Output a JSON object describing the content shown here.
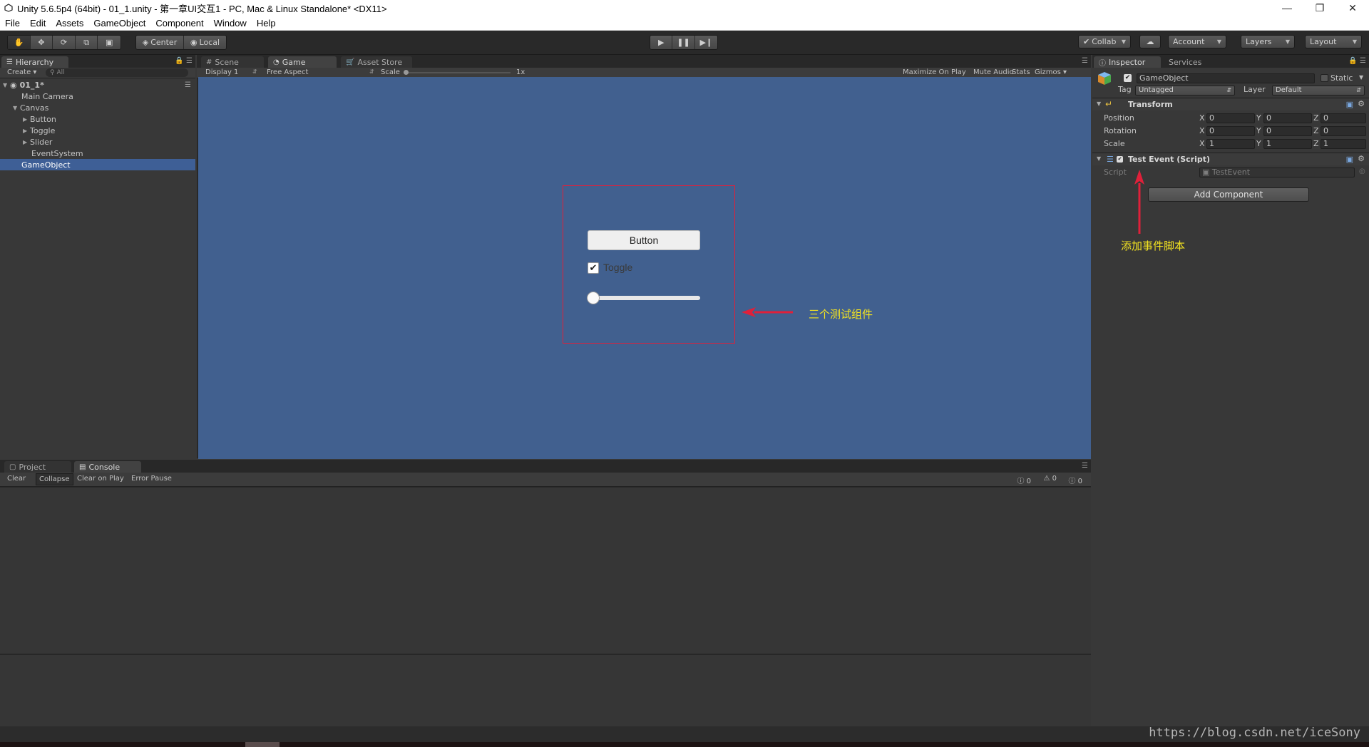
{
  "window": {
    "title": "Unity 5.6.5p4 (64bit) - 01_1.unity - 第一章UI交互1 - PC, Mac & Linux Standalone* <DX11>"
  },
  "menu": [
    "File",
    "Edit",
    "Assets",
    "GameObject",
    "Component",
    "Window",
    "Help"
  ],
  "toolbar": {
    "pivot": "Center",
    "space": "Local",
    "collab": "Collab",
    "account": "Account",
    "layers": "Layers",
    "layout": "Layout"
  },
  "hierarchy": {
    "tab": "Hierarchy",
    "create": "Create",
    "search_placeholder": "All",
    "scene": "01_1*",
    "items": [
      {
        "label": "Main Camera"
      },
      {
        "label": "Canvas"
      },
      {
        "label": "Button"
      },
      {
        "label": "Toggle"
      },
      {
        "label": "Slider"
      },
      {
        "label": "EventSystem"
      },
      {
        "label": "GameObject"
      }
    ]
  },
  "center": {
    "tabs": [
      "Scene",
      "Game",
      "Asset Store"
    ],
    "display": "Display 1",
    "aspect": "Free Aspect",
    "scale_label": "Scale",
    "scale_value": "1x",
    "opts": [
      "Maximize On Play",
      "Mute Audio",
      "Stats",
      "Gizmos"
    ]
  },
  "game": {
    "button_label": "Button",
    "toggle_label": "Toggle",
    "toggle_checked": true,
    "slider_value": 0,
    "annotation": "三个测试组件"
  },
  "inspector": {
    "tabs": [
      "Inspector",
      "Services"
    ],
    "object_name": "GameObject",
    "static_label": "Static",
    "tag_label": "Tag",
    "tag_value": "Untagged",
    "layer_label": "Layer",
    "layer_value": "Default",
    "transform": {
      "title": "Transform",
      "rows": [
        {
          "label": "Position",
          "x": "0",
          "y": "0",
          "z": "0"
        },
        {
          "label": "Rotation",
          "x": "0",
          "y": "0",
          "z": "0"
        },
        {
          "label": "Scale",
          "x": "1",
          "y": "1",
          "z": "1"
        }
      ]
    },
    "script_comp": {
      "title": "Test Event (Script)",
      "script_label": "Script",
      "script_value": "TestEvent"
    },
    "add_component": "Add Component",
    "annotation": "添加事件脚本"
  },
  "bottom": {
    "tabs": [
      "Project",
      "Console"
    ],
    "buttons": [
      "Clear",
      "Collapse",
      "Clear on Play",
      "Error Pause"
    ],
    "counts": {
      "info": "0",
      "warn": "0",
      "error": "0"
    }
  },
  "watermark": "https://blog.csdn.net/iceSony"
}
